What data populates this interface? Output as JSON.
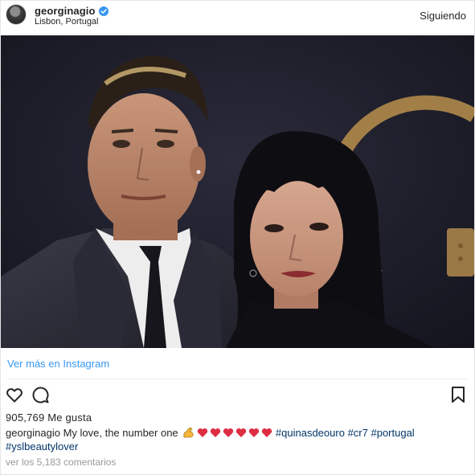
{
  "header": {
    "username": "georginagio",
    "location": "Lisbon, Portugal",
    "follow_label": "Siguiendo"
  },
  "post": {
    "view_more_label": "Ver más en Instagram",
    "likes_text": "905,769 Me gusta",
    "caption": {
      "user": "georginagio",
      "text": "My love, the number one",
      "emoji_icons": [
        "flexed-biceps",
        "red-heart",
        "red-heart",
        "red-heart",
        "red-heart",
        "red-heart",
        "red-heart"
      ],
      "hashtags_line1": [
        "#quinasdeouro",
        "#cr7",
        "#portugal"
      ],
      "hashtags_line2": [
        "#yslbeautylover"
      ]
    },
    "comments_text": "ver los 5,183 comentarios"
  },
  "colors": {
    "link_blue": "#3897f0",
    "hashtag": "#003569",
    "verified_blue": "#3897f0",
    "muted": "#999999"
  }
}
